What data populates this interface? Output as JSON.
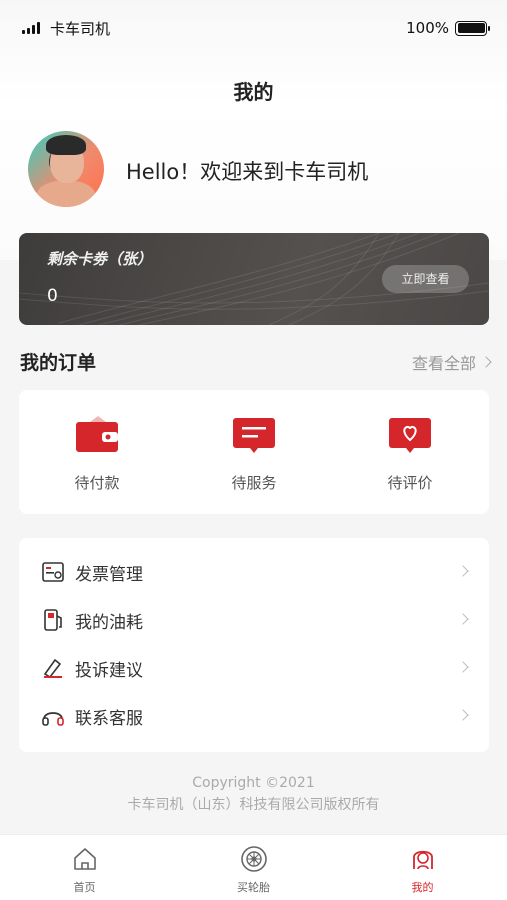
{
  "status_bar": {
    "carrier": "卡车司机",
    "battery": "100%"
  },
  "header": {
    "title": "我的"
  },
  "profile": {
    "greeting": "Hello！欢迎来到卡车司机"
  },
  "coupon": {
    "title": "剩余卡劵（张）",
    "count": "0",
    "button": "立即查看"
  },
  "orders": {
    "title": "我的订单",
    "view_all": "查看全部",
    "items": [
      {
        "label": "待付款",
        "icon": "wallet-icon"
      },
      {
        "label": "待服务",
        "icon": "message-icon"
      },
      {
        "label": "待评价",
        "icon": "heart-message-icon"
      }
    ]
  },
  "menu": [
    {
      "label": "发票管理",
      "icon": "invoice-icon"
    },
    {
      "label": "我的油耗",
      "icon": "fuel-icon"
    },
    {
      "label": "投诉建议",
      "icon": "feedback-icon"
    },
    {
      "label": "联系客服",
      "icon": "headset-icon"
    }
  ],
  "footer": {
    "copyright_line1": "Copyright ©2021",
    "copyright_line2": "卡车司机（山东）科技有限公司版权所有"
  },
  "tabbar": [
    {
      "label": "首页",
      "icon": "home-icon"
    },
    {
      "label": "买轮胎",
      "icon": "tire-icon"
    },
    {
      "label": "我的",
      "icon": "user-icon",
      "active": true
    }
  ],
  "colors": {
    "accent": "#d4262b",
    "card_dark": "#4a4746"
  }
}
